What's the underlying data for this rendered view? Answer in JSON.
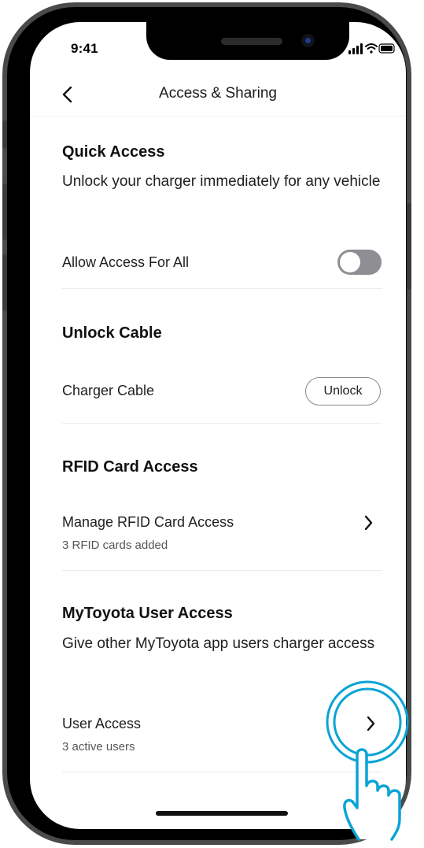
{
  "status_bar": {
    "time": "9:41"
  },
  "nav": {
    "title": "Access & Sharing"
  },
  "quick_access": {
    "heading": "Quick Access",
    "description": "Unlock your charger immediately for any vehicle",
    "toggle_label": "Allow Access For All",
    "toggle_on": false
  },
  "unlock_cable": {
    "heading": "Unlock Cable",
    "row_label": "Charger Cable",
    "button_label": "Unlock"
  },
  "rfid": {
    "heading": "RFID Card Access",
    "row_label": "Manage RFID Card Access",
    "row_sub": "3 RFID cards added"
  },
  "user_access": {
    "heading": "MyToyota User Access",
    "description": "Give other MyToyota app users charger access",
    "row_label": "User Access",
    "row_sub": "3 active users"
  },
  "colors": {
    "highlight": "#0aa4d6",
    "toggle_off": "#8e8e93"
  }
}
